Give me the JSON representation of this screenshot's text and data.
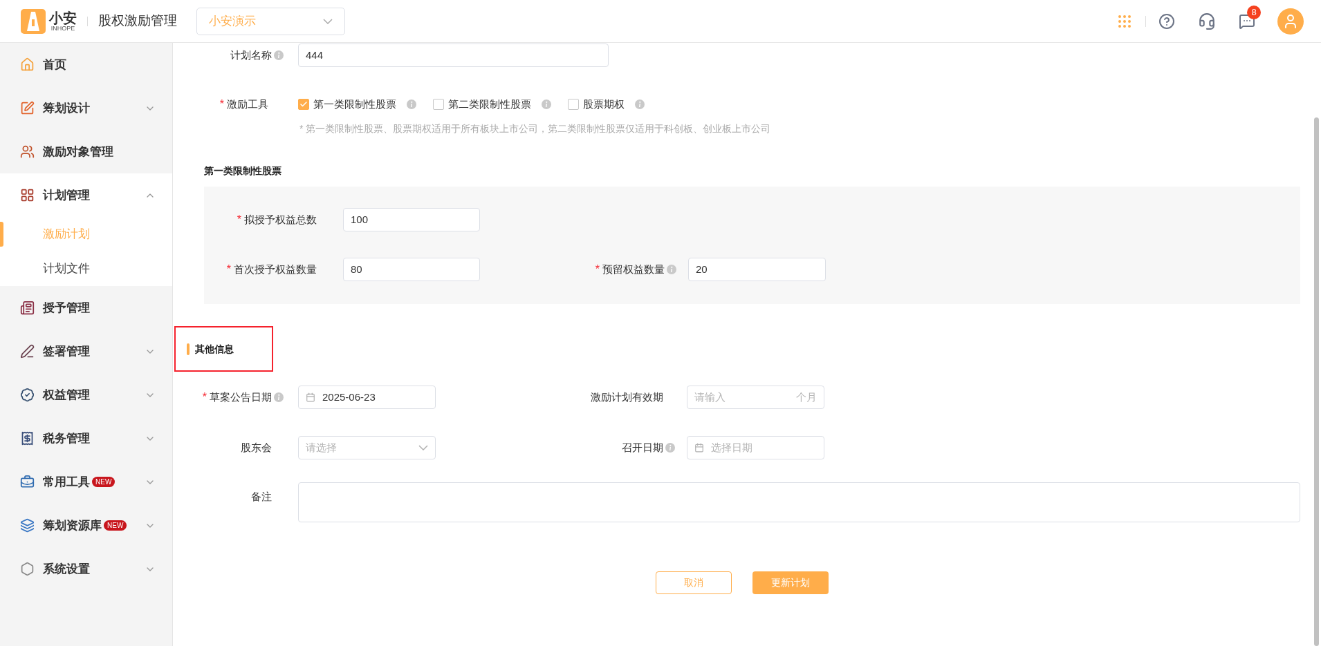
{
  "header": {
    "logo_text": "小安",
    "logo_subtext": "INHOPE",
    "app_title": "股权激励管理",
    "org_select": {
      "value": "小安演示"
    },
    "messages_badge": "8"
  },
  "sidebar": {
    "items": [
      {
        "label": "首页"
      },
      {
        "label": "筹划设计",
        "expanded": false
      },
      {
        "label": "激励对象管理"
      },
      {
        "label": "计划管理",
        "expanded": true,
        "children": [
          {
            "label": "激励计划",
            "selected": true
          },
          {
            "label": "计划文件",
            "selected": false
          }
        ]
      },
      {
        "label": "授予管理"
      },
      {
        "label": "签署管理",
        "expanded": false
      },
      {
        "label": "权益管理",
        "expanded": false
      },
      {
        "label": "税务管理",
        "expanded": false
      },
      {
        "label": "常用工具",
        "badge": "NEW",
        "expanded": false
      },
      {
        "label": "筹划资源库",
        "badge": "NEW",
        "expanded": false
      },
      {
        "label": "系统设置",
        "expanded": false
      }
    ]
  },
  "form": {
    "plan_name": {
      "label": "计划名称",
      "info": true,
      "value": "444"
    },
    "tools": {
      "label": "激励工具",
      "required_mark": "*",
      "options": [
        {
          "label": "第一类限制性股票",
          "checked": true
        },
        {
          "label": "第二类限制性股票",
          "checked": false
        },
        {
          "label": "股票期权",
          "checked": false
        }
      ],
      "note": "* 第一类限制性股票、股票期权适用于所有板块上市公司，第二类限制性股票仅适用于科创板、创业板上市公司"
    },
    "first_section": {
      "title": "第一类限制性股票",
      "rows": [
        [
          {
            "label": "拟授予权益总数",
            "required_mark": "*",
            "value": "100"
          }
        ],
        [
          {
            "label": "首次授予权益数量",
            "required_mark": "*",
            "value": "80"
          },
          {
            "label": "预留权益数量",
            "required_mark": "*",
            "info": true,
            "value": "20"
          }
        ]
      ]
    },
    "other_section": {
      "title": "其他信息",
      "highlighted": true,
      "rows": [
        [
          {
            "kind": "date",
            "label": "草案公告日期",
            "required_mark": "*",
            "info": true,
            "value": "2025-06-23"
          },
          {
            "kind": "unit",
            "label": "激励计划有效期",
            "placeholder": "请输入",
            "unit": "个月"
          }
        ],
        [
          {
            "kind": "select",
            "label": "股东会",
            "placeholder": "请选择"
          },
          {
            "kind": "date",
            "label": "召开日期",
            "info": true,
            "placeholder": "选择日期"
          }
        ]
      ],
      "remark": {
        "label": "备注"
      }
    },
    "buttons": {
      "cancel": "取消",
      "submit": "更新计划"
    }
  }
}
